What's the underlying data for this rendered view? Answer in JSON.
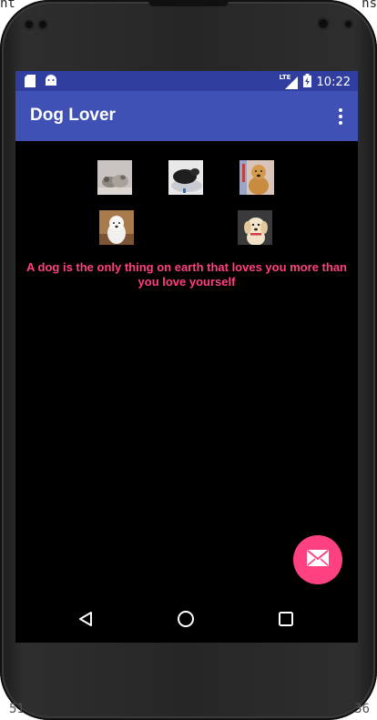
{
  "window_edges": {
    "top_left": "nt",
    "top_right": "ns",
    "bottom_left": "51",
    "bottom_right": "36"
  },
  "status_bar": {
    "network": "LTE",
    "time": "10:22",
    "color": "#303f9f"
  },
  "app_bar": {
    "title": "Dog Lover",
    "color": "#3f51b5",
    "menu_icon": "overflow-menu-icon"
  },
  "gallery": [
    {
      "name": "dog-photo-puppies-sleeping",
      "row": 1
    },
    {
      "name": "dog-photo-black-dog-bed",
      "row": 1
    },
    {
      "name": "dog-photo-golden-retriever",
      "row": 1
    },
    {
      "name": "dog-photo-westie",
      "row": 2
    },
    {
      "name": "dog-photo-golden-puppy",
      "row": 2
    }
  ],
  "quote": {
    "text": "A dog is the only thing on earth that loves you more than you love yourself",
    "color": "#ff4081"
  },
  "fab": {
    "icon": "email-icon",
    "color": "#ff4081"
  },
  "nav_bar": {
    "back": "back-icon",
    "home": "home-icon",
    "recents": "recents-icon"
  }
}
